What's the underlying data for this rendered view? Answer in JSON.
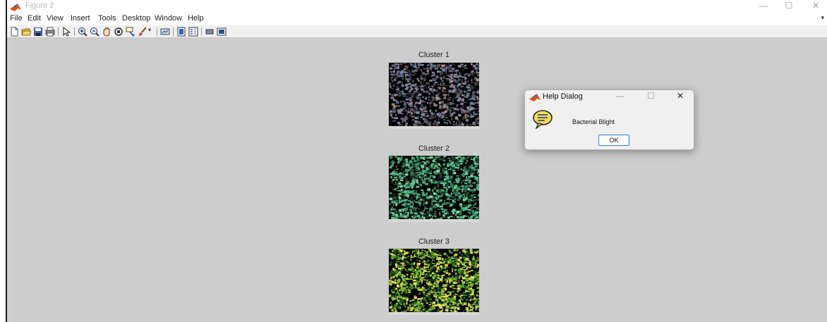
{
  "window": {
    "title": "Figure 2",
    "controls": {
      "minimize": "—",
      "maximize": "☐",
      "close": "✕"
    }
  },
  "menubar": {
    "items": [
      "File",
      "Edit",
      "View",
      "Insert",
      "Tools",
      "Desktop",
      "Window",
      "Help"
    ]
  },
  "toolbar": {
    "icons": [
      "new-figure-icon",
      "open-file-icon",
      "save-figure-icon",
      "print-figure-icon",
      "edit-plot-icon",
      "zoom-in-icon",
      "zoom-out-icon",
      "pan-icon",
      "rotate-3d-icon",
      "data-cursor-icon",
      "brush-icon",
      "brush-dropdown-icon",
      "link-plot-icon",
      "insert-colorbar-icon",
      "insert-legend-icon",
      "hide-plot-tools-icon",
      "show-plot-tools-icon"
    ]
  },
  "figure": {
    "clusters": [
      {
        "title": "Cluster 1"
      },
      {
        "title": "Cluster 2"
      },
      {
        "title": "Cluster 3"
      }
    ]
  },
  "dialog": {
    "title": "Help Dialog",
    "message": "Bacterial Blight",
    "ok_label": "OK",
    "controls": {
      "minimize": "—",
      "maximize": "☐",
      "close": "✕"
    }
  },
  "colors": {
    "figure_background": "#cdcdcd",
    "dialog_button_border": "#2f7bd6",
    "matlab_logo": "#d9541a"
  }
}
